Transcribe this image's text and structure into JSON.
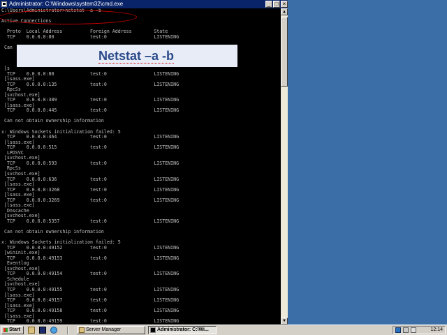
{
  "window": {
    "title": "Administrator: C:\\Windows\\system32\\cmd.exe",
    "minimize_glyph": "_",
    "maximize_glyph": "□",
    "close_glyph": "×"
  },
  "console": {
    "lines": [
      "C:\\Users\\Administrator>netstat -a -b",
      "",
      "Active Connections",
      "",
      "  Proto  Local Address          Foreign Address        State",
      "  TCP    0.0.0.0:80             test:0                 LISTENING",
      "",
      " Can",
      "",
      "",
      "",
      " [s",
      "  TCP    0.0.0.0:88             test:0                 LISTENING",
      " [lsass.exe]",
      "  TCP    0.0.0.0:135            test:0                 LISTENING",
      "  RpcSs",
      " [svchost.exe]",
      "  TCP    0.0.0.0:389            test:0                 LISTENING",
      " [lsass.exe]",
      "  TCP    0.0.0.0:445            test:0                 LISTENING",
      "",
      " Can not obtain ownership information",
      "",
      "x: Windows Sockets initialization failed: 5",
      "  TCP    0.0.0.0:464            test:0                 LISTENING",
      " [lsass.exe]",
      "  TCP    0.0.0.0:515            test:0                 LISTENING",
      "  LPDSVC",
      " [svchost.exe]",
      "  TCP    0.0.0.0:593            test:0                 LISTENING",
      "  RpcSs",
      " [svchost.exe]",
      "  TCP    0.0.0.0:636            test:0                 LISTENING",
      " [lsass.exe]",
      "  TCP    0.0.0.0:3268           test:0                 LISTENING",
      " [lsass.exe]",
      "  TCP    0.0.0.0:3269           test:0                 LISTENING",
      " [lsass.exe]",
      "  Dnscache",
      " [svchost.exe]",
      "  TCP    0.0.0.0:5357           test:0                 LISTENING",
      "",
      " Can not obtain ownership information",
      "",
      "x: Windows Sockets initialization failed: 5",
      "  TCP    0.0.0.0:49152          test:0                 LISTENING",
      " [wininit.exe]",
      "  TCP    0.0.0.0:49153          test:0                 LISTENING",
      "  Eventlog",
      " [svchost.exe]",
      "  TCP    0.0.0.0:49154          test:0                 LISTENING",
      "  Schedule",
      " [svchost.exe]",
      "  TCP    0.0.0.0:49155          test:0                 LISTENING",
      " [lsass.exe]",
      "  TCP    0.0.0.0:49157          test:0                 LISTENING",
      " [lsass.exe]",
      "  TCP    0.0.0.0:49158          test:0                 LISTENING",
      " [lsass.exe]",
      "  TCP    0.0.0.0:49159          test:0                 LISTENING"
    ]
  },
  "overlay": {
    "title": "Netstat –a -b"
  },
  "scrollbar": {
    "up_glyph": "▲",
    "down_glyph": "▼"
  },
  "taskbar": {
    "start_label": "Start",
    "tasks": [
      {
        "label": "Server Manager",
        "active": false
      },
      {
        "label": "Administrator: C:\\Wi...",
        "active": true
      }
    ],
    "clock": "12:14"
  },
  "colors": {
    "desktop": "#3a6ea5",
    "titlebar": "#0a246a",
    "console_bg": "#000000",
    "console_fg": "#c0c0c0",
    "overlay_bg": "#e8ecf7",
    "overlay_fg": "#2a4a8a",
    "highlight": "#d00000"
  }
}
